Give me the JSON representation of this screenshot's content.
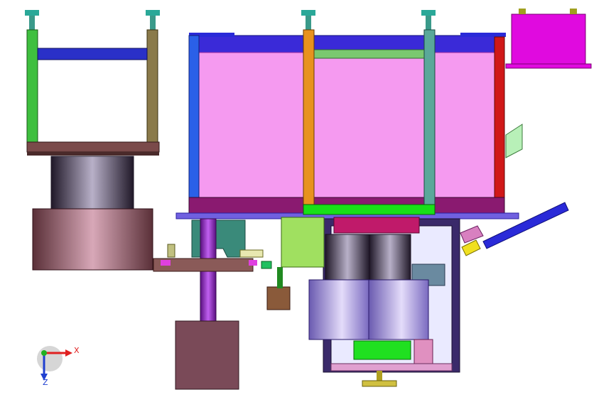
{
  "view": {
    "background": "#ffffff"
  },
  "triad": {
    "x_label": "X",
    "z_label": "Z",
    "x_color": "#e02020",
    "z_color": "#2040d0",
    "y_color": "#20b020"
  },
  "colors": {
    "magenta_panel": "#f59af0",
    "frame_blue": "#2a2ad8",
    "pillar_green": "#3fbf3f",
    "pillar_orange": "#e8921e",
    "pillar_teal": "#5aa89a",
    "pillar_olive": "#8a7a4a",
    "base_brown": "#7a4a4a",
    "cylinder_grey": "#6a6a8a",
    "housing_pink": "#e00adf"
  }
}
